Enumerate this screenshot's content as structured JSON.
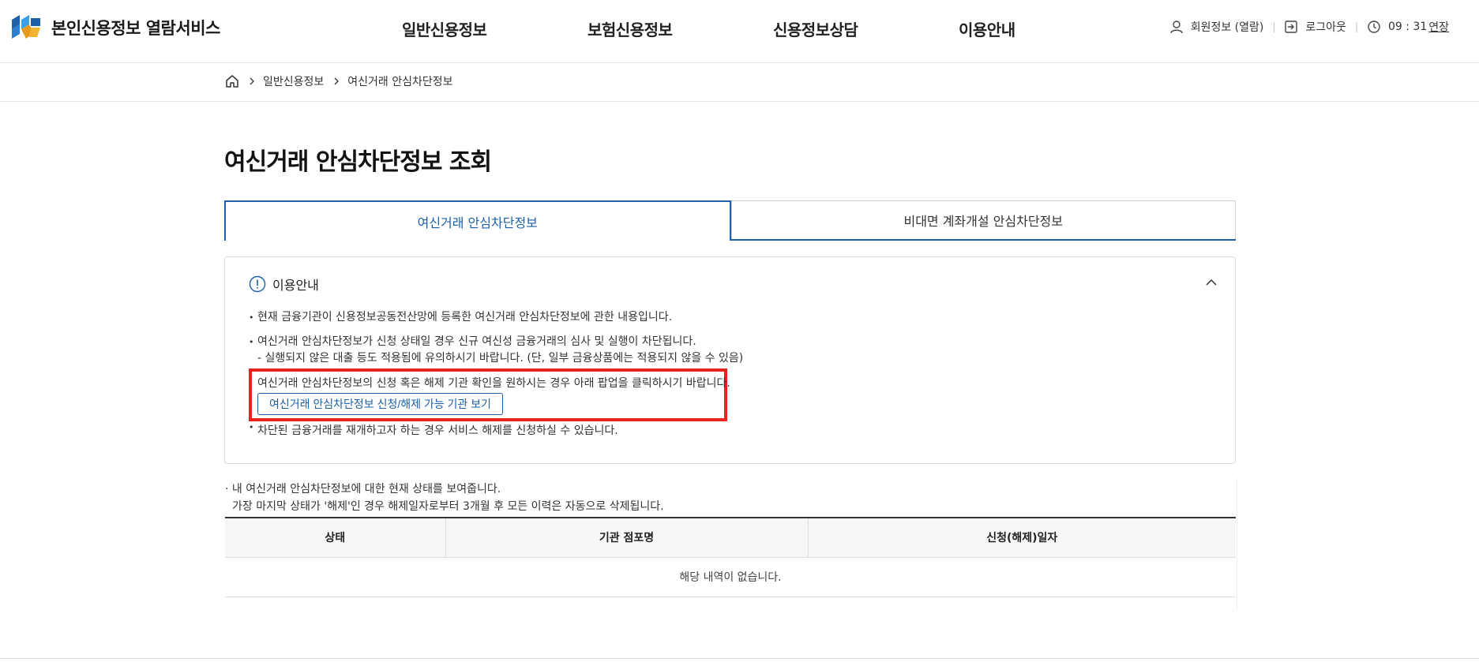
{
  "header": {
    "logo_text": "본인신용정보 열람서비스",
    "nav": [
      "일반신용정보",
      "보험신용정보",
      "신용정보상담",
      "이용안내"
    ],
    "util": {
      "member": "회원정보 (열람)",
      "logout": "로그아웃",
      "time": "09 : 31",
      "extend": "연장"
    }
  },
  "breadcrumb": [
    "일반신용정보",
    "여신거래 안심차단정보"
  ],
  "page_title": "여신거래 안심차단정보 조회",
  "tabs": [
    "여신거래 안심차단정보",
    "비대면 계좌개설 안심차단정보"
  ],
  "info": {
    "title": "이용안내",
    "items": [
      "현재 금융기관이 신용정보공동전산망에 등록한 여신거래 안심차단정보에 관한 내용입니다.",
      "여신거래 안심차단정보가 신청 상태일 경우 신규 여신성 금융거래의 심사 및 실행이 차단됩니다."
    ],
    "item2_sub": "- 실행되지 않은 대출 등도 적용됨에 유의하시기 바랍니다. (단, 일부 금융상품에는 적용되지 않을 수 있음)",
    "highlight_text": "여신거래 안심차단정보의 신청 혹은 해제 기관 확인을 원하시는 경우 아래 팝업을 클릭하시기 바랍니다.",
    "highlight_button": "여신거래 안심차단정보 신청/해제 가능 기관 보기",
    "last_item": "차단된 금융거래를 재개하고자 하는 경우 서비스 해제를 신청하실 수 있습니다."
  },
  "status_note": {
    "line1": "· 내 여신거래 안심차단정보에 대한 현재 상태를 보여줍니다.",
    "line2": "가장 마지막 상태가 '해제'인 경우 해제일자로부터 3개월 후 모든 이력은 자동으로 삭제됩니다."
  },
  "table": {
    "columns": [
      "상태",
      "기관 점포명",
      "신청(해제)일자"
    ],
    "empty_message": "해당 내역이 없습니다."
  },
  "colors": {
    "accent": "#1d5fa8",
    "highlight_border": "#e8231c"
  }
}
